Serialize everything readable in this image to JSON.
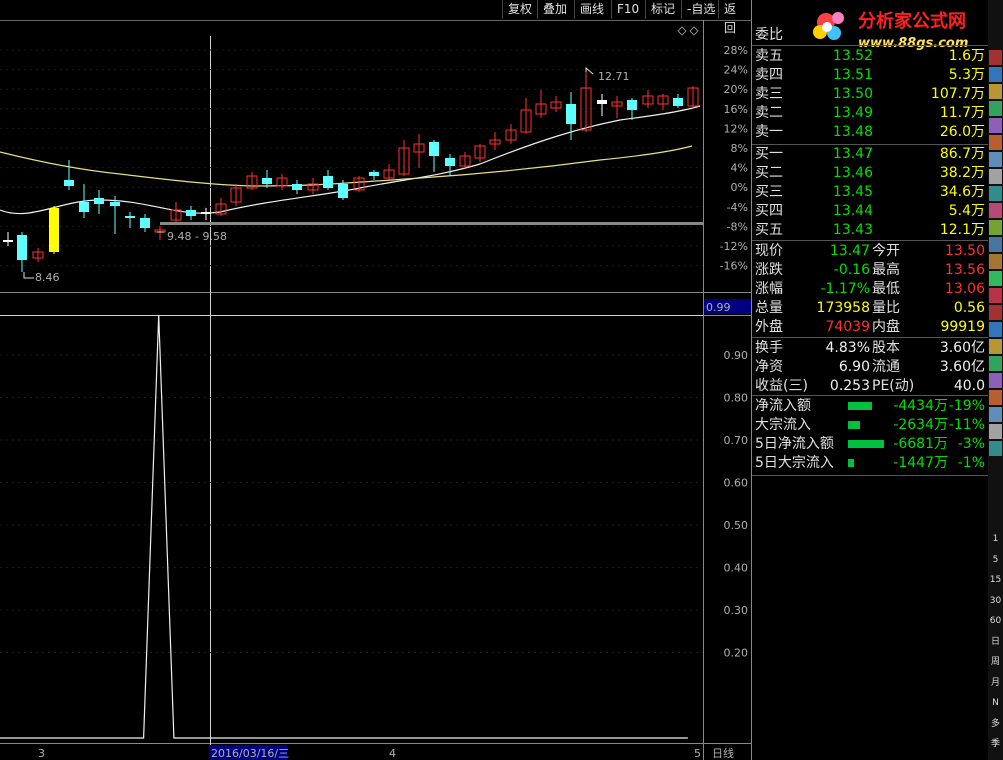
{
  "toolbar": {
    "buttons": [
      "复权",
      "叠加",
      "画线",
      "F10",
      "标记",
      "-自选",
      "返回"
    ]
  },
  "logo": {
    "name": "分析家公式网",
    "url": "www.88gs.com"
  },
  "chart": {
    "price_axis": [
      "28%",
      "24%",
      "20%",
      "16%",
      "12%",
      "8%",
      "4%",
      "0%",
      "-4%",
      "-8%",
      "-12%",
      "-16%"
    ],
    "annotations": {
      "high": "12.71",
      "low": "8.46",
      "range": "9.48 - 9.58"
    },
    "cursor_value": "0.99",
    "indicator_axis": [
      "0.90",
      "0.80",
      "0.70",
      "0.60",
      "0.50",
      "0.40",
      "0.30",
      "0.20"
    ],
    "date_labels": [
      "3",
      "2016/03/16/三",
      "4",
      "5"
    ],
    "period": "日线"
  },
  "chart_data": {
    "type": "line",
    "title": "",
    "series": [
      {
        "values": [
          0,
          0,
          0,
          0,
          0,
          0,
          0,
          0,
          0,
          0,
          1,
          0,
          0,
          0,
          0,
          0,
          0,
          0,
          0,
          0,
          0,
          0,
          0,
          0,
          0,
          0,
          0,
          0,
          0,
          0,
          0,
          0,
          0,
          0,
          0,
          0,
          0,
          0,
          0,
          0,
          0,
          0,
          0,
          0,
          0,
          0
        ]
      }
    ],
    "ylim": [
      0,
      1
    ]
  },
  "quote": {
    "weibi_label": "委比",
    "sell": [
      {
        "label": "卖五",
        "price": "13.52",
        "vol": "1.6万"
      },
      {
        "label": "卖四",
        "price": "13.51",
        "vol": "5.3万"
      },
      {
        "label": "卖三",
        "price": "13.50",
        "vol": "107.7万"
      },
      {
        "label": "卖二",
        "price": "13.49",
        "vol": "11.7万"
      },
      {
        "label": "卖一",
        "price": "13.48",
        "vol": "26.0万"
      }
    ],
    "buy": [
      {
        "label": "买一",
        "price": "13.47",
        "vol": "86.7万"
      },
      {
        "label": "买二",
        "price": "13.46",
        "vol": "38.2万"
      },
      {
        "label": "买三",
        "price": "13.45",
        "vol": "34.6万"
      },
      {
        "label": "买四",
        "price": "13.44",
        "vol": "5.4万"
      },
      {
        "label": "买五",
        "price": "13.43",
        "vol": "12.1万"
      }
    ],
    "stats": [
      {
        "l1": "现价",
        "v1": "13.47",
        "l2": "今开",
        "v2": "13.50"
      },
      {
        "l1": "涨跌",
        "v1": "-0.16",
        "l2": "最高",
        "v2": "13.56"
      },
      {
        "l1": "涨幅",
        "v1": "-1.17%",
        "l2": "最低",
        "v2": "13.06"
      },
      {
        "l1": "总量",
        "v1": "173958",
        "l2": "量比",
        "v2": "0.56"
      },
      {
        "l1": "外盘",
        "v1": "74039",
        "l2": "内盘",
        "v2": "99919"
      }
    ],
    "finance": [
      {
        "l1": "换手",
        "v1": "4.83%",
        "l2": "股本",
        "v2": "3.60亿"
      },
      {
        "l1": "净资",
        "v1": "6.90",
        "l2": "流通",
        "v2": "3.60亿"
      },
      {
        "l1": "收益(三)",
        "v1": "0.253",
        "l2": "PE(动)",
        "v2": "40.0"
      }
    ],
    "flows": [
      {
        "label": "净流入额",
        "value": "-4434万",
        "pct": "-19%"
      },
      {
        "label": "大宗流入",
        "value": "-2634万",
        "pct": "-11%"
      },
      {
        "label": "5日净流入额",
        "value": "-6681万",
        "pct": "-3%"
      },
      {
        "label": "5日大宗流入",
        "value": "-1447万",
        "pct": "-1%"
      }
    ]
  },
  "side_icons": [
    "1",
    "5",
    "15",
    "30",
    "60",
    "日",
    "周",
    "月",
    "N",
    "多",
    "季"
  ]
}
